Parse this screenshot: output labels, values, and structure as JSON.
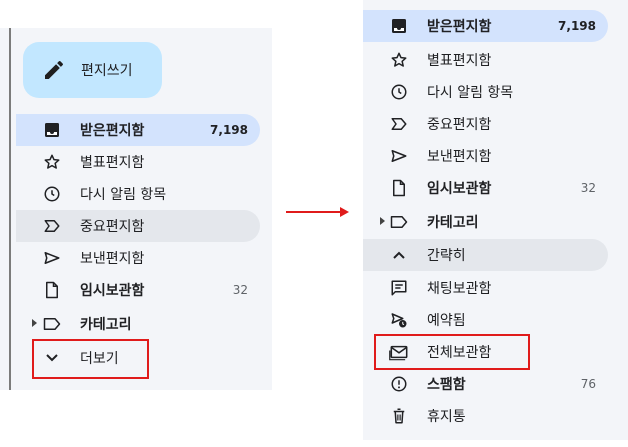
{
  "left_panel": {
    "compose_label": "편지쓰기",
    "items": [
      {
        "label": "받은편지함",
        "count": "7,198",
        "icon": "inbox-icon"
      },
      {
        "label": "별표편지함",
        "count": "",
        "icon": "star-icon"
      },
      {
        "label": "다시 알림 항목",
        "count": "",
        "icon": "clock-icon"
      },
      {
        "label": "중요편지함",
        "count": "",
        "icon": "important-icon"
      },
      {
        "label": "보낸편지함",
        "count": "",
        "icon": "send-icon"
      },
      {
        "label": "임시보관함",
        "count": "32",
        "icon": "draft-icon"
      },
      {
        "label": "카테고리",
        "count": "",
        "icon": "label-icon"
      },
      {
        "label": "더보기",
        "count": "",
        "icon": "chevron-down-icon"
      }
    ]
  },
  "right_panel": {
    "items": [
      {
        "label": "받은편지함",
        "count": "7,198",
        "icon": "inbox-icon"
      },
      {
        "label": "별표편지함",
        "count": "",
        "icon": "star-icon"
      },
      {
        "label": "다시 알림 항목",
        "count": "",
        "icon": "clock-icon"
      },
      {
        "label": "중요편지함",
        "count": "",
        "icon": "important-icon"
      },
      {
        "label": "보낸편지함",
        "count": "",
        "icon": "send-icon"
      },
      {
        "label": "임시보관함",
        "count": "32",
        "icon": "draft-icon"
      },
      {
        "label": "카테고리",
        "count": "",
        "icon": "label-icon"
      },
      {
        "label": "간략히",
        "count": "",
        "icon": "chevron-up-icon"
      },
      {
        "label": "채팅보관함",
        "count": "",
        "icon": "chat-icon"
      },
      {
        "label": "예약됨",
        "count": "",
        "icon": "scheduled-send-icon"
      },
      {
        "label": "전체보관함",
        "count": "",
        "icon": "all-mail-icon"
      },
      {
        "label": "스팸함",
        "count": "76",
        "icon": "spam-icon"
      },
      {
        "label": "휴지통",
        "count": "",
        "icon": "trash-icon"
      }
    ]
  },
  "colors": {
    "selected_bg": "#d3e3fd",
    "compose_bg": "#c2e7ff",
    "highlight_box": "#e01b1b",
    "arrow": "#e01b1b"
  }
}
